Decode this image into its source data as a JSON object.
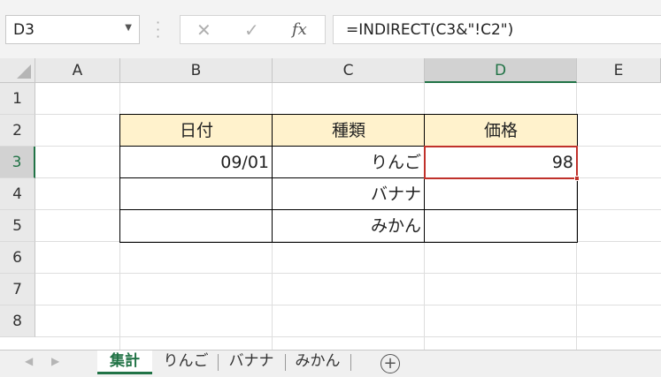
{
  "formula_bar": {
    "name_box": "D3",
    "cancel_icon": "✕",
    "enter_icon": "✓",
    "fx_label": "fx",
    "formula": "=INDIRECT(C3&\"!C2\")"
  },
  "columns": [
    "A",
    "B",
    "C",
    "D",
    "E"
  ],
  "selected_column": "D",
  "rows": [
    "1",
    "2",
    "3",
    "4",
    "5",
    "6",
    "7",
    "8"
  ],
  "selected_row": "3",
  "table": {
    "headers": [
      "日付",
      "種類",
      "価格"
    ],
    "rows": [
      [
        "09/01",
        "りんご",
        "98"
      ],
      [
        "",
        "バナナ",
        ""
      ],
      [
        "",
        "みかん",
        ""
      ]
    ]
  },
  "active_cell": "D3",
  "colors": {
    "header_fill": "#fff2cc",
    "active_border": "#c0312b",
    "excel_green": "#217346"
  },
  "sheet_tabs": {
    "tabs": [
      "集計",
      "りんご",
      "バナナ",
      "みかん"
    ],
    "active": "集計",
    "add_label": "+"
  }
}
